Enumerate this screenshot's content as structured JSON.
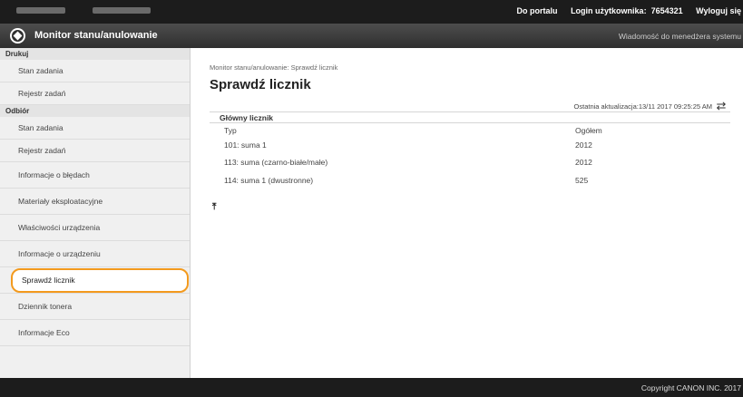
{
  "topbar": {
    "portal_link": "Do portalu",
    "login_label": "Login użytkownika:",
    "login_value": "7654321",
    "logout_link": "Wyloguj się"
  },
  "titlebar": {
    "app_title": "Monitor stanu/anulowanie",
    "message_link": "Wiadomość do menedżera systemu"
  },
  "sidebar": {
    "sections": [
      {
        "title": "Drukuj",
        "items": [
          "Stan zadania",
          "Rejestr zadań"
        ]
      },
      {
        "title": "Odbiór",
        "items": [
          "Stan zadania",
          "Rejestr zadań"
        ]
      }
    ],
    "items": [
      "Informacje o błędach",
      "Materiały eksploatacyjne",
      "Właściwości urządzenia",
      "Informacje o urządzeniu",
      "Sprawdź licznik",
      "Dziennik tonera",
      "Informacje Eco"
    ]
  },
  "main": {
    "breadcrumb": "Monitor stanu/anulowanie: Sprawdź licznik",
    "title": "Sprawdź licznik",
    "last_update": "Ostatnia aktualizacja:13/11 2017 09:25:25 AM",
    "section_title": "Główny licznik",
    "columns": [
      "Typ",
      "Ogółem"
    ],
    "rows": [
      [
        "101: suma 1",
        "2012"
      ],
      [
        "113: suma (czarno-białe/małe)",
        "2012"
      ],
      [
        "114: suma 1 (dwustronne)",
        "525"
      ]
    ],
    "to_top_icon": "to-top-icon"
  },
  "footer": {
    "copyright": "Copyright CANON INC. 2017"
  },
  "colors": {
    "active_outline": "#f39a1e",
    "topbar": "#1c1c1c"
  }
}
